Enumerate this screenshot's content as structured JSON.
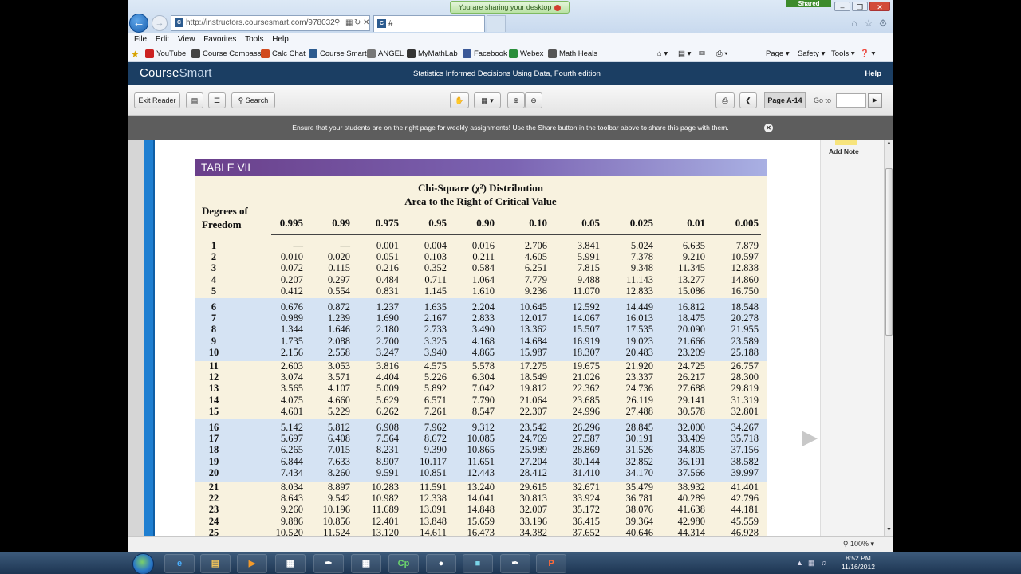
{
  "browser": {
    "url": "http://instructors.coursesmart.com/978032",
    "tab_title": "#",
    "sharing_banner": "You are sharing your desktop",
    "shared_tag": "Shared",
    "menu": [
      "File",
      "Edit",
      "View",
      "Favorites",
      "Tools",
      "Help"
    ],
    "favorites": [
      {
        "label": "YouTube",
        "color": "#cc2222"
      },
      {
        "label": "Course Compass",
        "color": "#444444"
      },
      {
        "label": "Calc Chat",
        "color": "#d14b1f"
      },
      {
        "label": "Course Smart",
        "color": "#2c5b8f"
      },
      {
        "label": "ANGEL",
        "color": "#777777"
      },
      {
        "label": "MyMathLab",
        "color": "#333333"
      },
      {
        "label": "Facebook",
        "color": "#3b5998"
      },
      {
        "label": "Webex",
        "color": "#2a8f3c"
      },
      {
        "label": "Math Heals",
        "color": "#555555"
      }
    ],
    "toolbar_right": {
      "page": "Page",
      "safety": "Safety",
      "tools": "Tools"
    },
    "zoom": "100%"
  },
  "app": {
    "logo_course": "Course",
    "logo_smart": "Smart",
    "book_title": "Statistics Informed Decisions Using Data, Fourth edition",
    "help": "Help",
    "exit_reader": "Exit Reader",
    "search": "Search",
    "page_indicator": "Page A-14",
    "goto_label": "Go to",
    "notice": "Ensure that your students are on the right page for weekly assignments! Use the Share button in the toolbar above to share this page with them.",
    "add_note": "Add Note"
  },
  "table": {
    "header": "TABLE VII",
    "caption1": "Chi-Square (χ²) Distribution",
    "caption2": "Area to the Right of Critical Value",
    "dof_line1": "Degrees of",
    "dof_line2": "Freedom",
    "columns": [
      "0.995",
      "0.99",
      "0.975",
      "0.95",
      "0.90",
      "0.10",
      "0.05",
      "0.025",
      "0.01",
      "0.005"
    ],
    "rows": [
      [
        "1",
        "—",
        "—",
        "0.001",
        "0.004",
        "0.016",
        "2.706",
        "3.841",
        "5.024",
        "6.635",
        "7.879"
      ],
      [
        "2",
        "0.010",
        "0.020",
        "0.051",
        "0.103",
        "0.211",
        "4.605",
        "5.991",
        "7.378",
        "9.210",
        "10.597"
      ],
      [
        "3",
        "0.072",
        "0.115",
        "0.216",
        "0.352",
        "0.584",
        "6.251",
        "7.815",
        "9.348",
        "11.345",
        "12.838"
      ],
      [
        "4",
        "0.207",
        "0.297",
        "0.484",
        "0.711",
        "1.064",
        "7.779",
        "9.488",
        "11.143",
        "13.277",
        "14.860"
      ],
      [
        "5",
        "0.412",
        "0.554",
        "0.831",
        "1.145",
        "1.610",
        "9.236",
        "11.070",
        "12.833",
        "15.086",
        "16.750"
      ],
      [
        "6",
        "0.676",
        "0.872",
        "1.237",
        "1.635",
        "2.204",
        "10.645",
        "12.592",
        "14.449",
        "16.812",
        "18.548"
      ],
      [
        "7",
        "0.989",
        "1.239",
        "1.690",
        "2.167",
        "2.833",
        "12.017",
        "14.067",
        "16.013",
        "18.475",
        "20.278"
      ],
      [
        "8",
        "1.344",
        "1.646",
        "2.180",
        "2.733",
        "3.490",
        "13.362",
        "15.507",
        "17.535",
        "20.090",
        "21.955"
      ],
      [
        "9",
        "1.735",
        "2.088",
        "2.700",
        "3.325",
        "4.168",
        "14.684",
        "16.919",
        "19.023",
        "21.666",
        "23.589"
      ],
      [
        "10",
        "2.156",
        "2.558",
        "3.247",
        "3.940",
        "4.865",
        "15.987",
        "18.307",
        "20.483",
        "23.209",
        "25.188"
      ],
      [
        "11",
        "2.603",
        "3.053",
        "3.816",
        "4.575",
        "5.578",
        "17.275",
        "19.675",
        "21.920",
        "24.725",
        "26.757"
      ],
      [
        "12",
        "3.074",
        "3.571",
        "4.404",
        "5.226",
        "6.304",
        "18.549",
        "21.026",
        "23.337",
        "26.217",
        "28.300"
      ],
      [
        "13",
        "3.565",
        "4.107",
        "5.009",
        "5.892",
        "7.042",
        "19.812",
        "22.362",
        "24.736",
        "27.688",
        "29.819"
      ],
      [
        "14",
        "4.075",
        "4.660",
        "5.629",
        "6.571",
        "7.790",
        "21.064",
        "23.685",
        "26.119",
        "29.141",
        "31.319"
      ],
      [
        "15",
        "4.601",
        "5.229",
        "6.262",
        "7.261",
        "8.547",
        "22.307",
        "24.996",
        "27.488",
        "30.578",
        "32.801"
      ],
      [
        "16",
        "5.142",
        "5.812",
        "6.908",
        "7.962",
        "9.312",
        "23.542",
        "26.296",
        "28.845",
        "32.000",
        "34.267"
      ],
      [
        "17",
        "5.697",
        "6.408",
        "7.564",
        "8.672",
        "10.085",
        "24.769",
        "27.587",
        "30.191",
        "33.409",
        "35.718"
      ],
      [
        "18",
        "6.265",
        "7.015",
        "8.231",
        "9.390",
        "10.865",
        "25.989",
        "28.869",
        "31.526",
        "34.805",
        "37.156"
      ],
      [
        "19",
        "6.844",
        "7.633",
        "8.907",
        "10.117",
        "11.651",
        "27.204",
        "30.144",
        "32.852",
        "36.191",
        "38.582"
      ],
      [
        "20",
        "7.434",
        "8.260",
        "9.591",
        "10.851",
        "12.443",
        "28.412",
        "31.410",
        "34.170",
        "37.566",
        "39.997"
      ],
      [
        "21",
        "8.034",
        "8.897",
        "10.283",
        "11.591",
        "13.240",
        "29.615",
        "32.671",
        "35.479",
        "38.932",
        "41.401"
      ],
      [
        "22",
        "8.643",
        "9.542",
        "10.982",
        "12.338",
        "14.041",
        "30.813",
        "33.924",
        "36.781",
        "40.289",
        "42.796"
      ],
      [
        "23",
        "9.260",
        "10.196",
        "11.689",
        "13.091",
        "14.848",
        "32.007",
        "35.172",
        "38.076",
        "41.638",
        "44.181"
      ],
      [
        "24",
        "9.886",
        "10.856",
        "12.401",
        "13.848",
        "15.659",
        "33.196",
        "36.415",
        "39.364",
        "42.980",
        "45.559"
      ],
      [
        "25",
        "10.520",
        "11.524",
        "13.120",
        "14.611",
        "16.473",
        "34.382",
        "37.652",
        "40.646",
        "44.314",
        "46.928"
      ]
    ]
  },
  "taskbar": {
    "time": "8:52 PM",
    "date": "11/16/2012",
    "cp_label": "Cp"
  }
}
